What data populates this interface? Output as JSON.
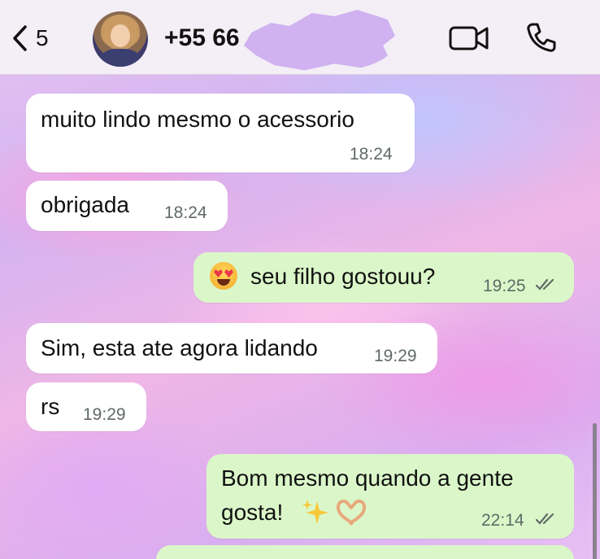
{
  "header": {
    "back_count": "5",
    "contact_name": "+55 66",
    "icons": {
      "back": "chevron-left-icon",
      "video": "video-camera-icon",
      "phone": "phone-icon"
    }
  },
  "messages": [
    {
      "direction": "incoming",
      "text": "muito lindo mesmo o acessorio",
      "time": "18:24"
    },
    {
      "direction": "incoming",
      "text": "obrigada",
      "time": "18:24"
    },
    {
      "direction": "outgoing",
      "emoji": "heart-eyes-emoji",
      "text": "seu filho gostouu?",
      "time": "19:25",
      "status": "read"
    },
    {
      "direction": "incoming",
      "text": "Sim, esta ate agora lidando",
      "time": "19:29"
    },
    {
      "direction": "incoming",
      "text": "rs",
      "time": "19:29"
    },
    {
      "direction": "outgoing",
      "text_line1": "Bom mesmo quando a gente",
      "text_line2": "gosta!",
      "emoji": "sparkles-heart-hands-emoji",
      "time": "22:14",
      "status": "read"
    }
  ],
  "colors": {
    "incoming_bubble": "#ffffff",
    "outgoing_bubble": "#dbf7c9",
    "header_bg": "#f4eef6"
  }
}
